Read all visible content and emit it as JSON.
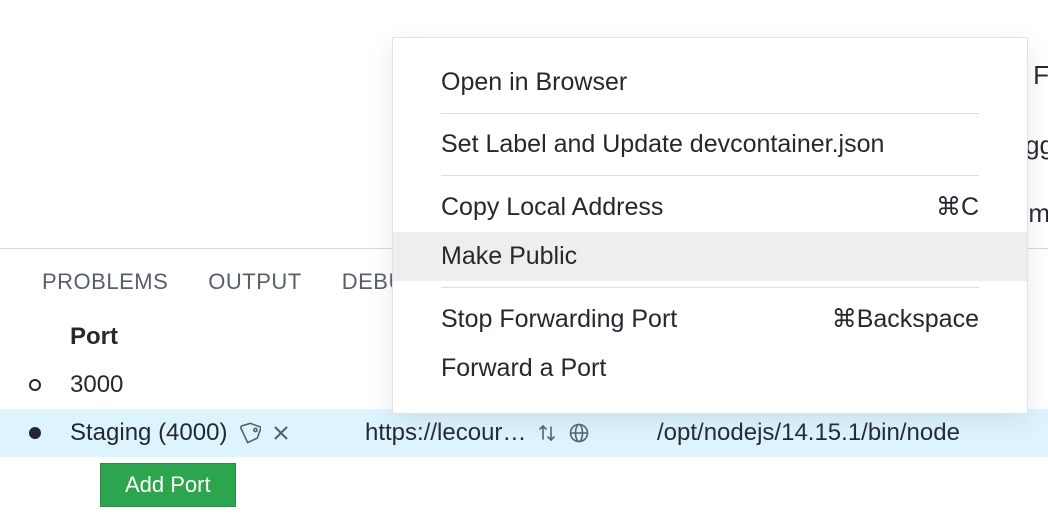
{
  "tabs": {
    "problems": "PROBLEMS",
    "output": "OUTPUT",
    "debug": "DEBU"
  },
  "ports_header": "Port",
  "rows": [
    {
      "filled": false,
      "port": "3000",
      "address": "",
      "process": ""
    },
    {
      "filled": true,
      "port": "Staging (4000)",
      "address": "https://lecour…",
      "process": "/opt/nodejs/14.15.1/bin/node"
    }
  ],
  "add_port_label": "Add Port",
  "context_menu": {
    "open_browser": "Open in Browser",
    "set_label": "Set Label and Update devcontainer.json",
    "copy_local": "Copy Local Address",
    "copy_local_shortcut": "⌘C",
    "make_public": "Make Public",
    "stop_forward": "Stop Forwarding Port",
    "stop_forward_shortcut": "⌘Backspace",
    "forward_port": "Forward a Port"
  },
  "bg": {
    "l1": "F",
    "l2": "gg",
    "l3": "m"
  }
}
